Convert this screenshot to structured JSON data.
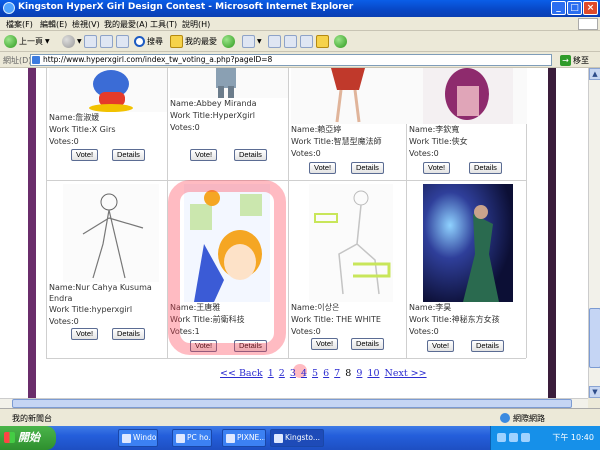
{
  "window": {
    "title": "Kingston HyperX Girl Design Contest - Microsoft Internet Explorer"
  },
  "menu": [
    "檔案(F)",
    "編輯(E)",
    "檢視(V)",
    "我的最愛(A)",
    "工具(T)",
    "說明(H)"
  ],
  "toolbar": {
    "back": "上一頁",
    "search": "搜尋",
    "favorites": "我的最愛"
  },
  "address": {
    "label": "網址(D)",
    "url": "http://www.hyperxgirl.com/index_tw_voting_a.php?pageID=8",
    "go": "移至"
  },
  "entries": [
    {
      "name": "Name:詹淑媛",
      "work": "Work Title:X Girs",
      "votes": "Votes:0",
      "vote_label": "Vote!",
      "details_label": "Details"
    },
    {
      "name": "Name:Abbey Miranda",
      "work": "Work Title:HyperXgirl",
      "votes": "Votes:0",
      "vote_label": "Vote!",
      "details_label": "Details"
    },
    {
      "name": "Name:賴亞婷",
      "work": "Work Title:智慧型魔法師",
      "votes": "Votes:0",
      "vote_label": "Vote!",
      "details_label": "Details"
    },
    {
      "name": "Name:李欽寬",
      "work": "Work Title:俠女",
      "votes": "Votes:0",
      "vote_label": "Vote!",
      "details_label": "Details"
    },
    {
      "name": "Name:Nur Cahya Kusuma",
      "name_cont": "Endra",
      "work": "Work Title:hyperxgirl",
      "votes": "Votes:0",
      "vote_label": "Vote!",
      "details_label": "Details"
    },
    {
      "name": "Name:王唐雅",
      "work": "Work Title:前衛科技",
      "votes": "Votes:1",
      "vote_label": "Vote!",
      "details_label": "Details"
    },
    {
      "name": "Name:이상은",
      "work": "Work Title: THE WHITE",
      "votes": "Votes:0",
      "vote_label": "Vote!",
      "details_label": "Details"
    },
    {
      "name": "Name:李昊",
      "work": "Work Title:神秘东方女孩",
      "votes": "Votes:0",
      "vote_label": "Vote!",
      "details_label": "Details"
    }
  ],
  "pager": {
    "back": "<< Back",
    "pages": [
      "1",
      "2",
      "3",
      "4",
      "5",
      "6",
      "7",
      "8",
      "9",
      "10"
    ],
    "current": "8",
    "next": "Next >>"
  },
  "status": {
    "left": "我的新聞台",
    "zone": "網際網路"
  },
  "taskbar": {
    "start": "開始",
    "items": [
      "Windo...",
      "PC ho...",
      "PIXNE...",
      "Kingsto..."
    ],
    "clock": "下午 10:40"
  }
}
